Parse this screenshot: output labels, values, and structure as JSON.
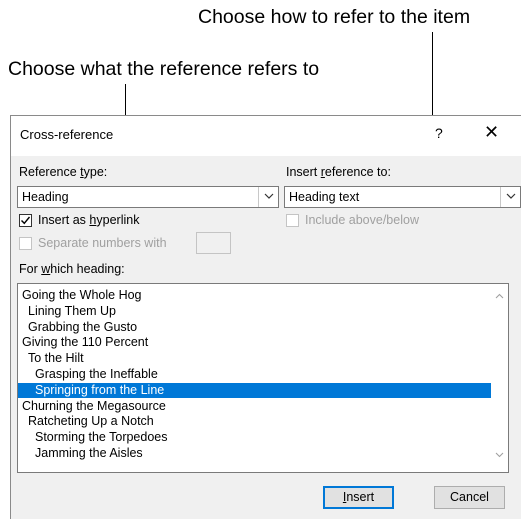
{
  "callouts": {
    "top": "Choose how to refer to the item",
    "second": "Choose what the reference refers to"
  },
  "dialog": {
    "title": "Cross-reference",
    "help": "?",
    "close": "✕",
    "reference_type_label_pre": "Reference ",
    "reference_type_label_key": "t",
    "reference_type_label_post": "ype:",
    "reference_type_value": "Heading",
    "insert_reference_label_pre": "Insert ",
    "insert_reference_label_key": "r",
    "insert_reference_label_post": "eference to:",
    "insert_reference_value": "Heading text",
    "hyperlink_label_pre": "Insert as ",
    "hyperlink_label_key": "h",
    "hyperlink_label_post": "yperlink",
    "hyperlink_checked": true,
    "include_above_below_label": "Include above/below",
    "separate_numbers_label": "Separate numbers with",
    "for_which_label_pre": "For ",
    "for_which_label_key": "w",
    "for_which_label_post": "hich heading:",
    "headings": [
      {
        "text": "Going the Whole Hog",
        "level": 1,
        "selected": false
      },
      {
        "text": "Lining Them Up",
        "level": 2,
        "selected": false
      },
      {
        "text": "Grabbing the Gusto",
        "level": 2,
        "selected": false
      },
      {
        "text": "Giving the 110 Percent",
        "level": 1,
        "selected": false
      },
      {
        "text": "To the Hilt",
        "level": 2,
        "selected": false
      },
      {
        "text": "Grasping the Ineffable",
        "level": 3,
        "selected": false
      },
      {
        "text": "Springing from the Line",
        "level": 3,
        "selected": true
      },
      {
        "text": "Churning the Megasource",
        "level": 1,
        "selected": false
      },
      {
        "text": "Ratcheting Up a Notch",
        "level": 2,
        "selected": false
      },
      {
        "text": "Storming the Torpedoes",
        "level": 3,
        "selected": false
      },
      {
        "text": "Jamming the Aisles",
        "level": 3,
        "selected": false
      }
    ],
    "insert_button_key": "I",
    "insert_button_rest": "nsert",
    "cancel_button": "Cancel",
    "colors": {
      "selection": "#0078d7",
      "accent_border": "#0078d7"
    }
  }
}
